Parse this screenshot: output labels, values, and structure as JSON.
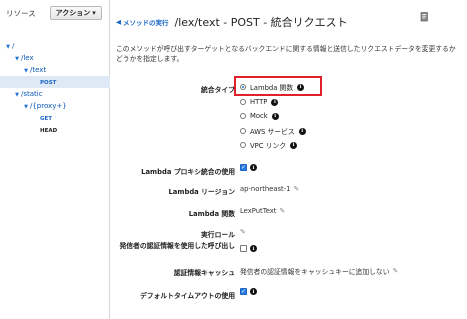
{
  "sidebar": {
    "title": "リソース",
    "action_label": "アクション",
    "tree": [
      {
        "label": "/",
        "type": "resource",
        "indent": 0
      },
      {
        "label": "/lex",
        "type": "resource",
        "indent": 1
      },
      {
        "label": "/text",
        "type": "resource",
        "indent": 2
      },
      {
        "label": "POST",
        "type": "method",
        "indent": 3,
        "selected": true
      },
      {
        "label": "/static",
        "type": "resource",
        "indent": 1
      },
      {
        "label": "/{proxy+}",
        "type": "resource",
        "indent": 2
      },
      {
        "label": "GET",
        "type": "method",
        "indent": 3
      },
      {
        "label": "HEAD",
        "type": "method",
        "indent": 3
      }
    ]
  },
  "header": {
    "back_label": "メソッドの実行",
    "title": "/lex/text - POST - 統合リクエスト"
  },
  "description": "このメソッドが呼び出すターゲットとなるバックエンドに関する情報と送信したリクエストデータを変更するかどうかを指定します。",
  "form": {
    "integration_type_label": "統合タイプ",
    "integration_options": [
      {
        "label": "Lambda 関数",
        "checked": true,
        "info": true
      },
      {
        "label": "HTTP",
        "checked": false,
        "info": true
      },
      {
        "label": "Mock",
        "checked": false,
        "info": true
      },
      {
        "label": "AWS サービス",
        "checked": false,
        "info": true
      },
      {
        "label": "VPC リンク",
        "checked": false,
        "info": true
      }
    ],
    "proxy_label": "Lambda プロキシ統合の使用",
    "proxy_checked": true,
    "region_label": "Lambda リージョン",
    "region_value": "ap-northeast-1",
    "function_label": "Lambda 関数",
    "function_value": "LexPutText",
    "role_label": "実行ロール",
    "caller_cred_label": "発信者の認証情報を使用した呼び出し",
    "caller_cred_checked": false,
    "cred_cache_label": "認証情報キャッシュ",
    "cred_cache_value": "発信者の認証情報をキャッシュキーに追加しない",
    "timeout_label": "デフォルトタイムアウトの使用",
    "timeout_checked": true
  },
  "colors": {
    "link": "#1866c7",
    "highlight": "#e0202a",
    "selected_bg": "#dfe9f6",
    "checkbox": "#2a7ae2"
  }
}
